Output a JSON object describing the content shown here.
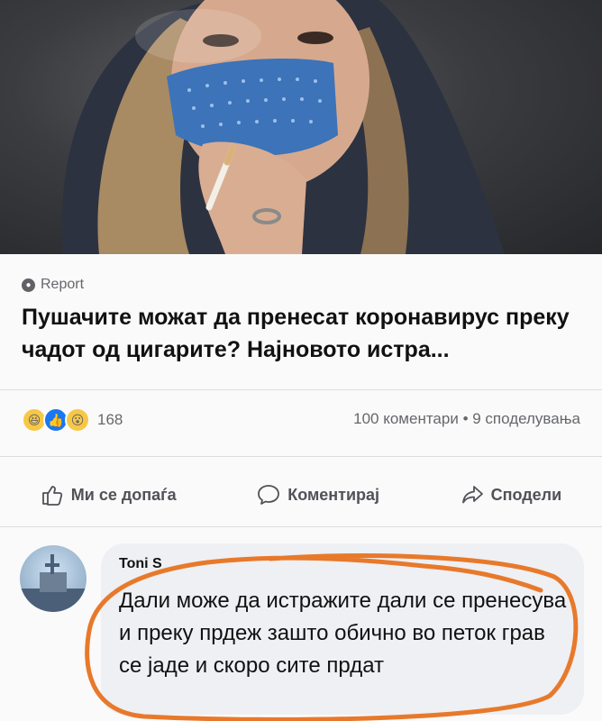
{
  "post": {
    "source": "Report",
    "headline": "Пушачите можат да пренесат коронавирус преку чадот од цигарите? Најновото истра..."
  },
  "engagement": {
    "reaction_count": "168",
    "stats": "100 коментари • 9 споделувања"
  },
  "actions": {
    "like": "Ми се допаѓа",
    "comment": "Коментирај",
    "share": "Сподели"
  },
  "comment": {
    "author": "Toni S",
    "text": "Дали може да истражите дали се пренесува и преку прдеж зашто обично во петок грав се јаде и скоро сите прдат"
  },
  "colors": {
    "annotation_circle": "#e8792b",
    "mask": "#3d73b8",
    "link_blue": "#1877f2"
  }
}
